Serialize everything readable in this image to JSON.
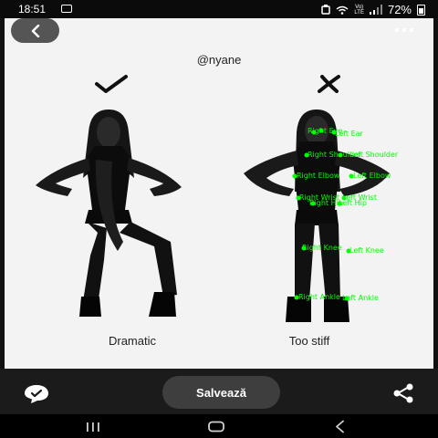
{
  "status_bar": {
    "time": "18:51",
    "network_top": "Vo)",
    "network_bottom": "LTE",
    "battery": "72%"
  },
  "post": {
    "handle": "@nyane",
    "good_caption": "Dramatic",
    "bad_caption": "Too stiff",
    "good_mark": "check-icon",
    "bad_mark": "cross-icon"
  },
  "keypoints": {
    "labels": {
      "right_eye": "Right Eye",
      "left_ear": "Left Ear",
      "right_shoulder": "Right Shoulder",
      "left_shoulder": "Left Shoulder",
      "right_elbow": "Right Elbow",
      "left_elbow": "Left Elbow",
      "right_wrist": "Right Wrist",
      "left_wrist": "Left Wrist",
      "right_hip": "Right Hip",
      "left_hip": "Left Hip",
      "right_knee": "Right Knee",
      "left_knee": "Left Knee",
      "right_ankle": "Right Ankle",
      "left_ankle": "Left Ankle"
    },
    "color": "#00ff00"
  },
  "actions": {
    "save_label": "Salvează"
  },
  "colors": {
    "accent": "#00ff00",
    "background": "#111111",
    "card": "#f3f3f3"
  }
}
